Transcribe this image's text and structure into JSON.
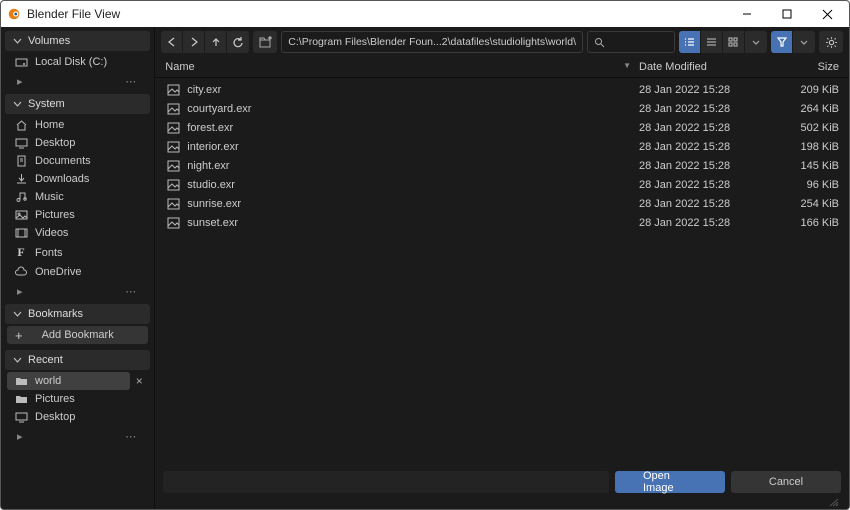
{
  "window": {
    "title": "Blender File View"
  },
  "sidebar": {
    "sections": [
      {
        "label": "Volumes",
        "items": [
          {
            "icon": "disk",
            "label": "Local Disk (C:)",
            "selected": false
          }
        ],
        "footer": true
      },
      {
        "label": "System",
        "items": [
          {
            "icon": "home",
            "label": "Home"
          },
          {
            "icon": "desktop",
            "label": "Desktop"
          },
          {
            "icon": "docs",
            "label": "Documents"
          },
          {
            "icon": "download",
            "label": "Downloads"
          },
          {
            "icon": "music",
            "label": "Music"
          },
          {
            "icon": "picture",
            "label": "Pictures"
          },
          {
            "icon": "video",
            "label": "Videos"
          },
          {
            "icon": "font",
            "label": "Fonts"
          },
          {
            "icon": "cloud",
            "label": "OneDrive"
          }
        ],
        "footer": true
      },
      {
        "label": "Bookmarks",
        "items": [],
        "addbtn": "Add Bookmark"
      },
      {
        "label": "Recent",
        "items": [
          {
            "icon": "folder",
            "label": "world",
            "selected": true,
            "removable": true
          },
          {
            "icon": "folder",
            "label": "Pictures"
          },
          {
            "icon": "desktop",
            "label": "Desktop"
          }
        ],
        "footer": true
      }
    ]
  },
  "toolbar": {
    "path": "C:\\Program Files\\Blender Foun...2\\datafiles\\studiolights\\world\\"
  },
  "columns": {
    "name": "Name",
    "date": "Date Modified",
    "size": "Size"
  },
  "files": [
    {
      "name": "city.exr",
      "date": "28 Jan 2022 15:28",
      "size": "209 KiB"
    },
    {
      "name": "courtyard.exr",
      "date": "28 Jan 2022 15:28",
      "size": "264 KiB"
    },
    {
      "name": "forest.exr",
      "date": "28 Jan 2022 15:28",
      "size": "502 KiB"
    },
    {
      "name": "interior.exr",
      "date": "28 Jan 2022 15:28",
      "size": "198 KiB"
    },
    {
      "name": "night.exr",
      "date": "28 Jan 2022 15:28",
      "size": "145 KiB"
    },
    {
      "name": "studio.exr",
      "date": "28 Jan 2022 15:28",
      "size": "96 KiB"
    },
    {
      "name": "sunrise.exr",
      "date": "28 Jan 2022 15:28",
      "size": "254 KiB"
    },
    {
      "name": "sunset.exr",
      "date": "28 Jan 2022 15:28",
      "size": "166 KiB"
    }
  ],
  "buttons": {
    "open": "Open Image",
    "cancel": "Cancel"
  }
}
